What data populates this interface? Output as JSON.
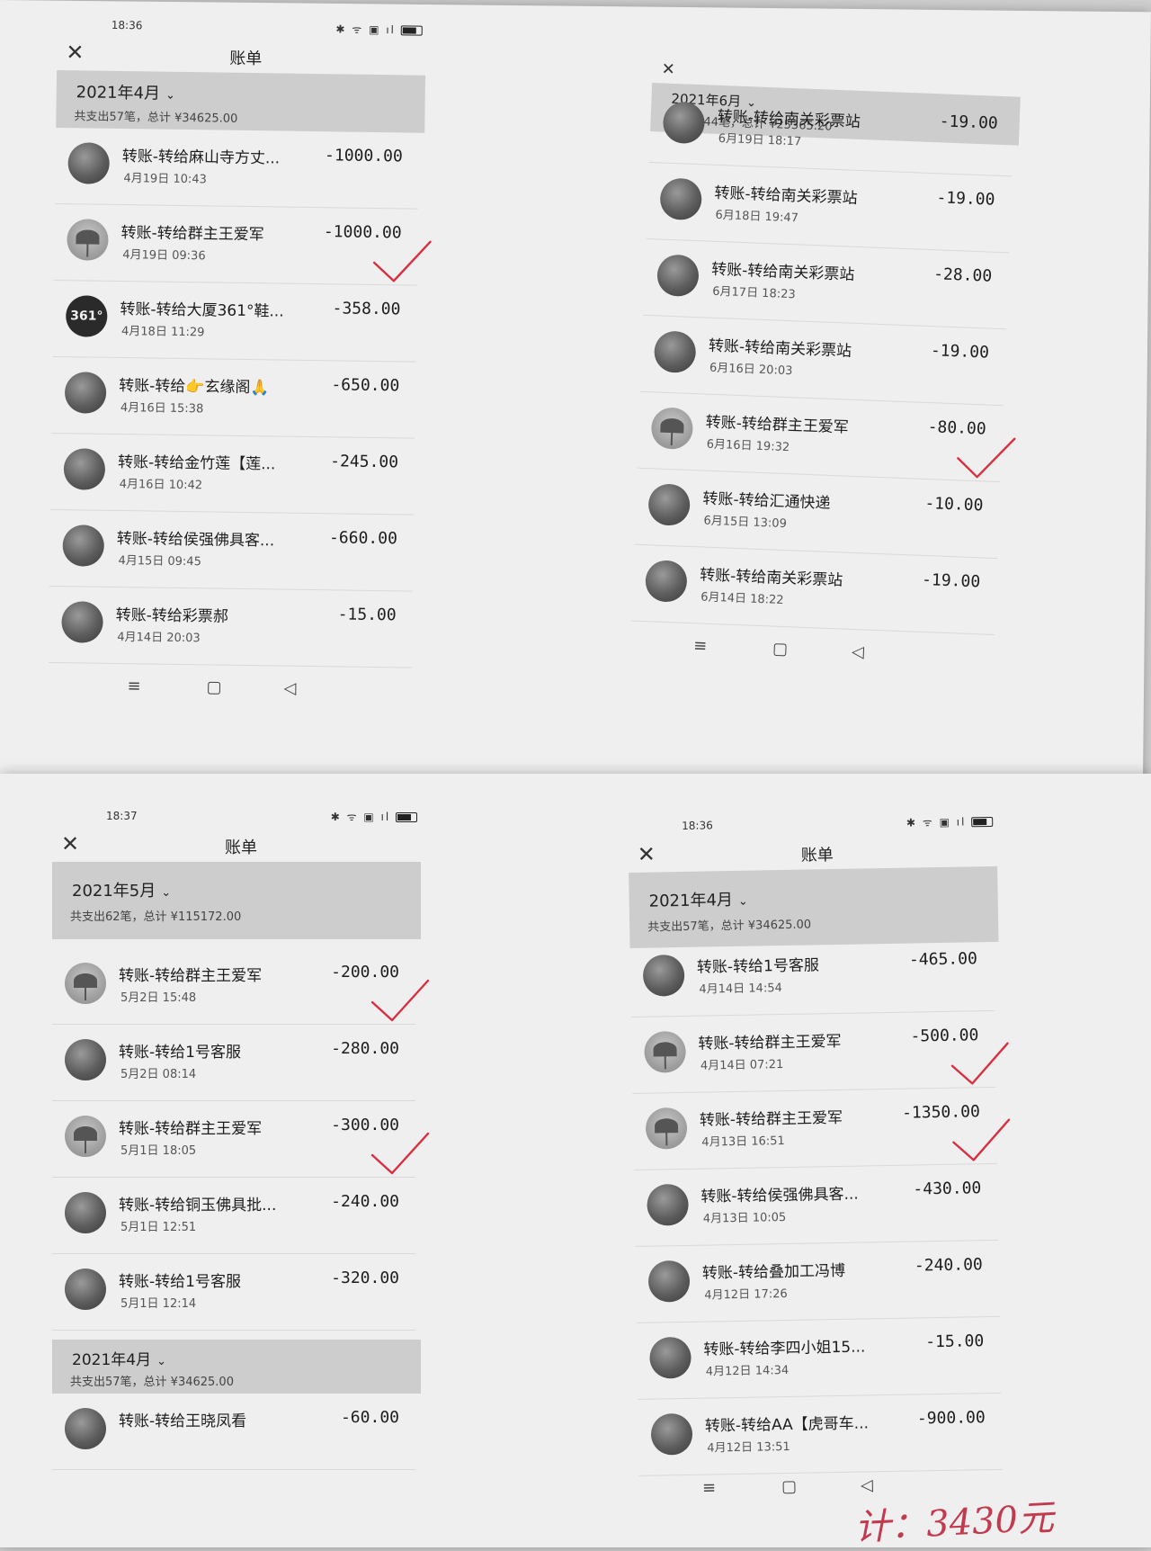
{
  "screens": [
    {
      "time": "18:36",
      "title": "账单",
      "month": "2021年4月",
      "summary": "共支出57笔，总计 ¥34625.00",
      "rows": [
        {
          "name": "转账-转给麻山寺方丈...",
          "date": "4月19日 10:43",
          "amount": "-1000.00",
          "checked": false,
          "avatar": "photo"
        },
        {
          "name": "转账-转给群主王爱军",
          "date": "4月19日 09:36",
          "amount": "-1000.00",
          "checked": true,
          "avatar": "leaf"
        },
        {
          "name": "转账-转给大厦361°鞋...",
          "date": "4月18日 11:29",
          "amount": "-358.00",
          "checked": false,
          "avatar": "361"
        },
        {
          "name": "转账-转给👉玄缘阁🙏",
          "date": "4月16日 15:38",
          "amount": "-650.00",
          "checked": false,
          "avatar": "photo"
        },
        {
          "name": "转账-转给金竹莲【莲...",
          "date": "4月16日 10:42",
          "amount": "-245.00",
          "checked": false,
          "avatar": "photo"
        },
        {
          "name": "转账-转给侯强佛具客...",
          "date": "4月15日 09:45",
          "amount": "-660.00",
          "checked": false,
          "avatar": "photo"
        },
        {
          "name": "转账-转给彩票郝",
          "date": "4月14日 20:03",
          "amount": "-15.00",
          "checked": false,
          "avatar": "photo"
        }
      ]
    },
    {
      "time": "",
      "title": "账单",
      "month": "2021年6月",
      "summary": "共支出44笔，总计 ¥25365.20",
      "rows": [
        {
          "name": "转账-转给南关彩票站",
          "date": "6月19日 18:17",
          "amount": "-19.00",
          "checked": false,
          "avatar": "photo"
        },
        {
          "name": "转账-转给南关彩票站",
          "date": "6月18日 19:47",
          "amount": "-19.00",
          "checked": false,
          "avatar": "photo"
        },
        {
          "name": "转账-转给南关彩票站",
          "date": "6月17日 18:23",
          "amount": "-28.00",
          "checked": false,
          "avatar": "photo"
        },
        {
          "name": "转账-转给南关彩票站",
          "date": "6月16日 20:03",
          "amount": "-19.00",
          "checked": false,
          "avatar": "photo"
        },
        {
          "name": "转账-转给群主王爱军",
          "date": "6月16日 19:32",
          "amount": "-80.00",
          "checked": true,
          "avatar": "leaf"
        },
        {
          "name": "转账-转给汇通快递",
          "date": "6月15日 13:09",
          "amount": "-10.00",
          "checked": false,
          "avatar": "photo"
        },
        {
          "name": "转账-转给南关彩票站",
          "date": "6月14日 18:22",
          "amount": "-19.00",
          "checked": false,
          "avatar": "photo"
        }
      ]
    },
    {
      "time": "18:37",
      "title": "账单",
      "month": "2021年5月",
      "summary": "共支出62笔，总计 ¥115172.00",
      "rows": [
        {
          "name": "转账-转给群主王爱军",
          "date": "5月2日 15:48",
          "amount": "-200.00",
          "checked": true,
          "avatar": "leaf"
        },
        {
          "name": "转账-转给1号客服",
          "date": "5月2日 08:14",
          "amount": "-280.00",
          "checked": false,
          "avatar": "photo"
        },
        {
          "name": "转账-转给群主王爱军",
          "date": "5月1日 18:05",
          "amount": "-300.00",
          "checked": true,
          "avatar": "leaf"
        },
        {
          "name": "转账-转给铜玉佛具批...",
          "date": "5月1日 12:51",
          "amount": "-240.00",
          "checked": false,
          "avatar": "photo"
        },
        {
          "name": "转账-转给1号客服",
          "date": "5月1日 12:14",
          "amount": "-320.00",
          "checked": false,
          "avatar": "photo"
        }
      ],
      "sub_month": "2021年4月",
      "sub_summary": "共支出57笔，总计 ¥34625.00",
      "sub_rows": [
        {
          "name": "转账-转给王晓凤看",
          "date": "",
          "amount": "-60.00",
          "checked": false,
          "avatar": "photo"
        }
      ]
    },
    {
      "time": "18:36",
      "title": "账单",
      "month": "2021年4月",
      "summary": "共支出57笔，总计 ¥34625.00",
      "rows": [
        {
          "name": "转账-转给1号客服",
          "date": "4月14日 14:54",
          "amount": "-465.00",
          "checked": false,
          "avatar": "photo"
        },
        {
          "name": "转账-转给群主王爱军",
          "date": "4月14日 07:21",
          "amount": "-500.00",
          "checked": true,
          "avatar": "leaf"
        },
        {
          "name": "转账-转给群主王爱军",
          "date": "4月13日 16:51",
          "amount": "-1350.00",
          "checked": true,
          "avatar": "leaf"
        },
        {
          "name": "转账-转给侯强佛具客...",
          "date": "4月13日 10:05",
          "amount": "-430.00",
          "checked": false,
          "avatar": "photo"
        },
        {
          "name": "转账-转给叠加工冯博",
          "date": "4月12日 17:26",
          "amount": "-240.00",
          "checked": false,
          "avatar": "photo"
        },
        {
          "name": "转账-转给李四小姐15...",
          "date": "4月12日 14:34",
          "amount": "-15.00",
          "checked": false,
          "avatar": "photo"
        },
        {
          "name": "转账-转给AA【虎哥车...",
          "date": "4月12日 13:51",
          "amount": "-900.00",
          "checked": false,
          "avatar": "photo"
        }
      ]
    }
  ],
  "nav": {
    "menu": "≡",
    "home": "▢",
    "back": "◁"
  },
  "handwritten_note": "计：3430元",
  "colors": {
    "check": "#d83040",
    "note": "#c23a4e",
    "header_band": "#cdcdcd"
  }
}
